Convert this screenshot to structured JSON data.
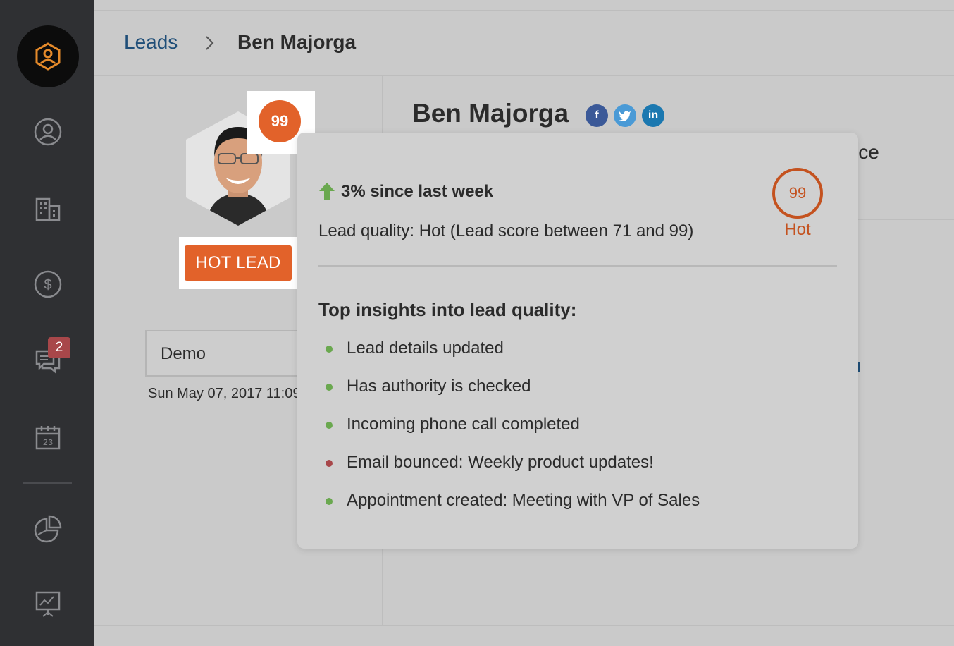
{
  "breadcrumb": {
    "parent": "Leads",
    "current": "Ben Majorga"
  },
  "sidebar": {
    "notifications_badge": "2"
  },
  "lead": {
    "name": "Ben Majorga",
    "score": "99",
    "status_label": "HOT LEAD",
    "partial_text": "ice"
  },
  "activity": {
    "title": "Demo",
    "date": "Sun May 07, 2017 11:09"
  },
  "popover": {
    "trend": "3% since last week",
    "quality": "Lead quality: Hot (Lead score between 71 and 99)",
    "score": "99",
    "rating": "Hot",
    "insights_title": "Top insights into lead quality:",
    "insights": [
      {
        "text": "Lead details updated",
        "type": "positive"
      },
      {
        "text": "Has authority is checked",
        "type": "positive"
      },
      {
        "text": "Incoming phone call completed",
        "type": "positive"
      },
      {
        "text": "Email bounced: Weekly product updates!",
        "type": "negative"
      },
      {
        "text": "Appointment created: Meeting with VP of Sales",
        "type": "positive"
      }
    ]
  },
  "colors": {
    "accent": "#e2622a",
    "positive": "#6aa84f",
    "negative": "#a8474a",
    "link": "#1f4e78"
  }
}
